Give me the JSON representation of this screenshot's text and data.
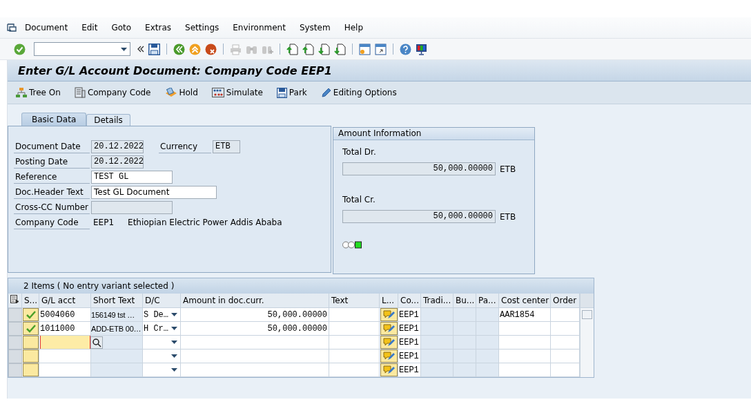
{
  "menu": [
    "Document",
    "Edit",
    "Goto",
    "Extras",
    "Settings",
    "Environment",
    "System",
    "Help"
  ],
  "title": "Enter G/L Account Document: Company Code EEP1",
  "app_toolbar": [
    {
      "label": "Tree On",
      "kind": "tree"
    },
    {
      "label": "Company Code",
      "kind": "company"
    },
    {
      "label": "Hold",
      "kind": "hold"
    },
    {
      "label": "Simulate",
      "kind": "simulate"
    },
    {
      "label": "Park",
      "kind": "park"
    },
    {
      "label": "Editing Options",
      "kind": "edit"
    }
  ],
  "tabs": [
    {
      "label": "Basic Data",
      "selected": true
    },
    {
      "label": "Details",
      "selected": false
    }
  ],
  "header": {
    "document_date": {
      "label": "Document Date",
      "value": "20.12.2022"
    },
    "currency": {
      "label": "Currency",
      "value": "ETB"
    },
    "posting_date": {
      "label": "Posting Date",
      "value": "20.12.2022"
    },
    "reference": {
      "label": "Reference",
      "value": "TEST GL"
    },
    "doc_header_text": {
      "label": "Doc.Header Text",
      "value": "Test GL Document"
    },
    "cross_cc_number": {
      "label": "Cross-CC Number"
    },
    "company_code": {
      "label": "Company Code",
      "value": "EEP1",
      "name": "Ethiopian Electric Power Addis Ababa"
    }
  },
  "amount_information": {
    "title": "Amount Information",
    "total_dr": {
      "label": "Total Dr.",
      "value": "50,000.00000",
      "currency": "ETB"
    },
    "total_cr": {
      "label": "Total Cr.",
      "value": "50,000.00000",
      "currency": "ETB"
    },
    "balanced": true
  },
  "items": {
    "title": "2 Items ( No entry variant selected )",
    "columns": [
      "S...",
      "G/L acct",
      "Short Text",
      "D/C",
      "Amount in doc.curr.",
      "Text",
      "L...",
      "Co...",
      "Tradi...",
      "Bu...",
      "Pa...",
      "Cost center",
      "Order"
    ],
    "rows": [
      {
        "checked": true,
        "gl_acct": "5004060",
        "short_text": "156149 tst …",
        "dc": "S De…",
        "amount": "50,000.00000",
        "company": "EEP1",
        "cost_center": "AAR1854",
        "focused": false
      },
      {
        "checked": true,
        "gl_acct": "1011000",
        "short_text": "ADD-ETB 00…",
        "dc": "H Cr…",
        "amount": "50,000.00000",
        "company": "EEP1",
        "focused": false
      },
      {
        "checked": false,
        "company": "EEP1",
        "focused": true
      },
      {
        "checked": false,
        "company": "EEP1",
        "focused": false
      },
      {
        "checked": false,
        "company": "EEP1",
        "focused": false
      }
    ]
  }
}
